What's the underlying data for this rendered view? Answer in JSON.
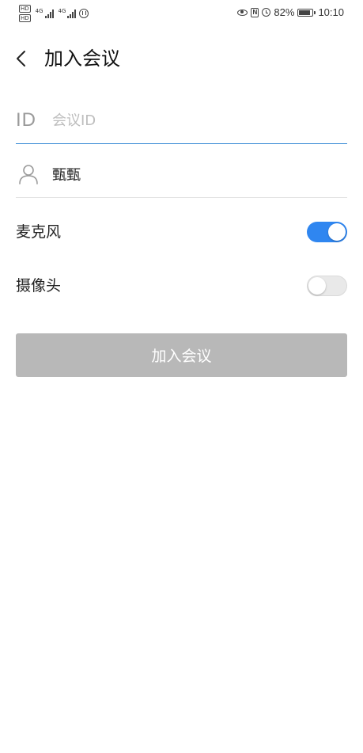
{
  "status_bar": {
    "hd_labels": [
      "HD",
      "HD"
    ],
    "network_1": "4G",
    "network_2": "4G",
    "battery_percent": "82%",
    "battery_level": 0.82,
    "time": "10:10",
    "icons": [
      "signal-icon",
      "hand-icon",
      "eye-icon",
      "nfc-icon",
      "alarm-icon",
      "battery-icon"
    ]
  },
  "header": {
    "back_icon": "chevron-left-icon",
    "title": "加入会议"
  },
  "form": {
    "meeting_id": {
      "icon_text": "ID",
      "placeholder": "会议ID",
      "value": ""
    },
    "display_name": {
      "icon": "user-icon",
      "value": "甄甄"
    }
  },
  "toggles": {
    "microphone": {
      "label": "麦克风",
      "on": true
    },
    "camera": {
      "label": "摄像头",
      "on": false
    }
  },
  "join_button": {
    "label": "加入会议",
    "enabled": false
  },
  "colors": {
    "accent": "#2f86f0",
    "input_focus_line": "#2f86d3",
    "disabled_button": "#b8b8b8",
    "divider": "#e2e2e2",
    "placeholder": "#bdbdbd"
  }
}
